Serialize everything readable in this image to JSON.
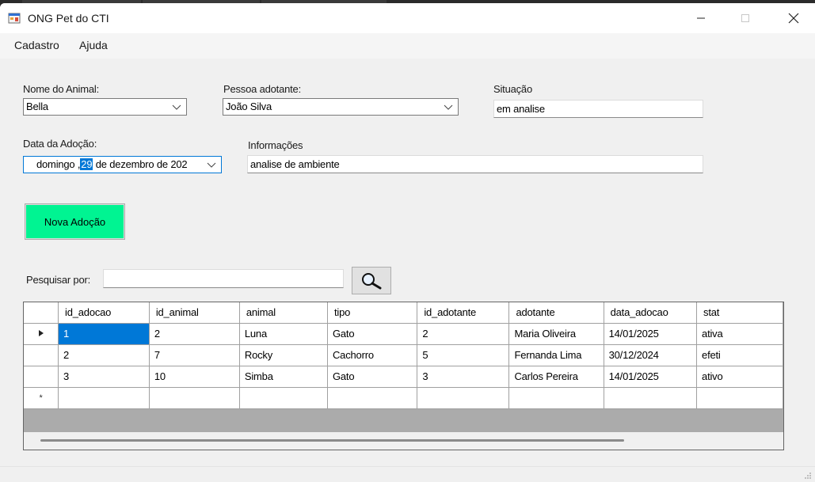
{
  "window": {
    "title": "ONG Pet do CTI",
    "icon": "app-form-icon",
    "controls": {
      "minimize": "─",
      "maximize": "☐",
      "close": "✕"
    }
  },
  "menu": {
    "items": [
      {
        "label": "Cadastro"
      },
      {
        "label": "Ajuda"
      }
    ]
  },
  "form": {
    "animal_label": "Nome do Animal:",
    "animal_value": "Bella",
    "adotante_label": "Pessoa adotante:",
    "adotante_value": "João Silva",
    "situacao_label": "Situação",
    "situacao_value": "em analise",
    "data_label": "Data da Adoção:",
    "data_weekday": "domingo",
    "data_sep": " ,",
    "data_day": "29",
    "data_rest": "de dezembro de 202",
    "info_label": "Informações",
    "info_value": "analise de ambiente",
    "nova_button": "Nova Adoção",
    "nova_button_color": "#00f492",
    "pesquisar_label": "Pesquisar por:",
    "pesquisar_value": ""
  },
  "grid": {
    "columns": [
      "id_adocao",
      "id_animal",
      "animal",
      "tipo",
      "id_adotante",
      "adotante",
      "data_adocao",
      "stat"
    ],
    "rows": [
      [
        "1",
        "2",
        "Luna",
        "Gato",
        "2",
        "Maria Oliveira",
        "14/01/2025",
        "ativa"
      ],
      [
        "2",
        "7",
        "Rocky",
        "Cachorro",
        "5",
        "Fernanda Lima",
        "30/12/2024",
        "efeti"
      ],
      [
        "3",
        "10",
        "Simba",
        "Gato",
        "3",
        "Carlos Pereira",
        "14/01/2025",
        "ativo"
      ]
    ],
    "current_row_marker": "▶",
    "new_row_marker": "*",
    "selection_color": "#0078d7"
  }
}
